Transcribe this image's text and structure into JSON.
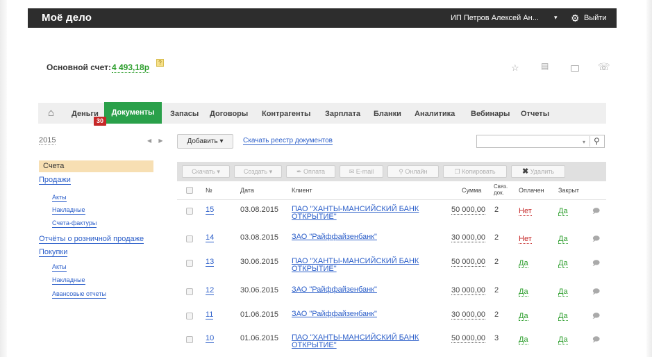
{
  "topbar": {
    "logo": "Моё дело",
    "user": "ИП Петров Алексей Ан...",
    "user_caret": "▾",
    "settings_icon": "gear-icon",
    "logout": "Выйти"
  },
  "account": {
    "label": "Основной счет:",
    "balance": "4 493,18р",
    "help": "?"
  },
  "toolbar_icons": [
    "star-icon",
    "chat-icon",
    "card-icon",
    "phone-icon"
  ],
  "nav": {
    "home_icon": "home-icon",
    "items": [
      "Деньги",
      "Документы",
      "Запасы",
      "Договоры",
      "Контрагенты",
      "Зарплата",
      "Бланки",
      "Аналитика",
      "Вебинары",
      "Отчеты"
    ],
    "active": "Документы",
    "badge": "30"
  },
  "sidebar": {
    "year": "2015",
    "year_nav": "◀ ▶",
    "selected": "Счета",
    "links": [
      {
        "label": "Продажи",
        "level": 0
      },
      {
        "label": "Акты",
        "level": 1
      },
      {
        "label": "Накладные",
        "level": 1
      },
      {
        "label": "Счета-фактуры",
        "level": 1
      },
      {
        "label": "Отчёты о розничной продаже",
        "level": 0
      },
      {
        "label": "Покупки",
        "level": 0
      },
      {
        "label": "Акты",
        "level": 1
      },
      {
        "label": "Накладные",
        "level": 1
      },
      {
        "label": "Авансовые отчеты",
        "level": 1
      }
    ]
  },
  "toolbar": {
    "add": "Добавить",
    "download_registry": "Скачать реестр документов",
    "search_placeholder": "",
    "search_caret": "▾"
  },
  "actions": {
    "download": "Скачать ▾",
    "create": "Создать ▾",
    "pay": "Оплата",
    "email": "E-mail",
    "online": "Онлайн",
    "copy": "Копировать",
    "delete": "Удалить"
  },
  "table": {
    "headers": {
      "num": "№",
      "date": "Дата",
      "client": "Клиент",
      "sum": "Сумма",
      "linked": "Связ. док.",
      "paid": "Оплачен",
      "closed": "Закрыт"
    },
    "rows": [
      {
        "num": "15",
        "date": "03.08.2015",
        "client": "ПАО \"ХАНТЫ-МАНСИЙСКИЙ БАНК ОТКРЫТИЕ\"",
        "sum": "50 000,00",
        "linked": "2",
        "paid": "Нет",
        "closed": "Да"
      },
      {
        "num": "14",
        "date": "03.08.2015",
        "client": "ЗАО \"Райффайзенбанк\"",
        "sum": "30 000,00",
        "linked": "2",
        "paid": "Нет",
        "closed": "Да"
      },
      {
        "num": "13",
        "date": "30.06.2015",
        "client": "ПАО \"ХАНТЫ-МАНСИЙСКИЙ БАНК ОТКРЫТИЕ\"",
        "sum": "50 000,00",
        "linked": "2",
        "paid": "Да",
        "closed": "Да"
      },
      {
        "num": "12",
        "date": "30.06.2015",
        "client": "ЗАО \"Райффайзенбанк\"",
        "sum": "30 000,00",
        "linked": "2",
        "paid": "Да",
        "closed": "Да"
      },
      {
        "num": "11",
        "date": "01.06.2015",
        "client": "ЗАО \"Райффайзенбанк\"",
        "sum": "30 000,00",
        "linked": "2",
        "paid": "Да",
        "closed": "Да"
      },
      {
        "num": "10",
        "date": "01.06.2015",
        "client": "ПАО \"ХАНТЫ-МАНСИЙСКИЙ БАНК ОТКРЫТИЕ\"",
        "sum": "50 000,00",
        "linked": "3",
        "paid": "Да",
        "closed": "Да"
      }
    ]
  },
  "colors": {
    "topbar": "#2d2d2d",
    "accent_green": "#2aa04a",
    "badge_red": "#c62828",
    "link_blue": "#2b5ec9",
    "selected_bg": "#f7dfb3"
  }
}
